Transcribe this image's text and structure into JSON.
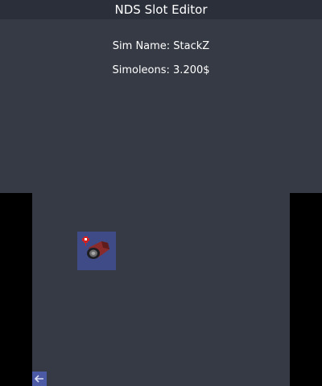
{
  "app": {
    "title": "NDS Slot Editor"
  },
  "top_screen": {
    "sim_name": "Sim Name: StackZ",
    "simoleons": "Simoleons: 3.200$"
  },
  "bottom_screen": {
    "slot_item_icon": "red-log-item-icon",
    "back_icon": "back-arrow-icon"
  },
  "colors": {
    "background": "#363a44",
    "title_bar": "#2b2f3a",
    "slot_highlight": "#3f4b86",
    "back_button": "#4c5aa6"
  }
}
